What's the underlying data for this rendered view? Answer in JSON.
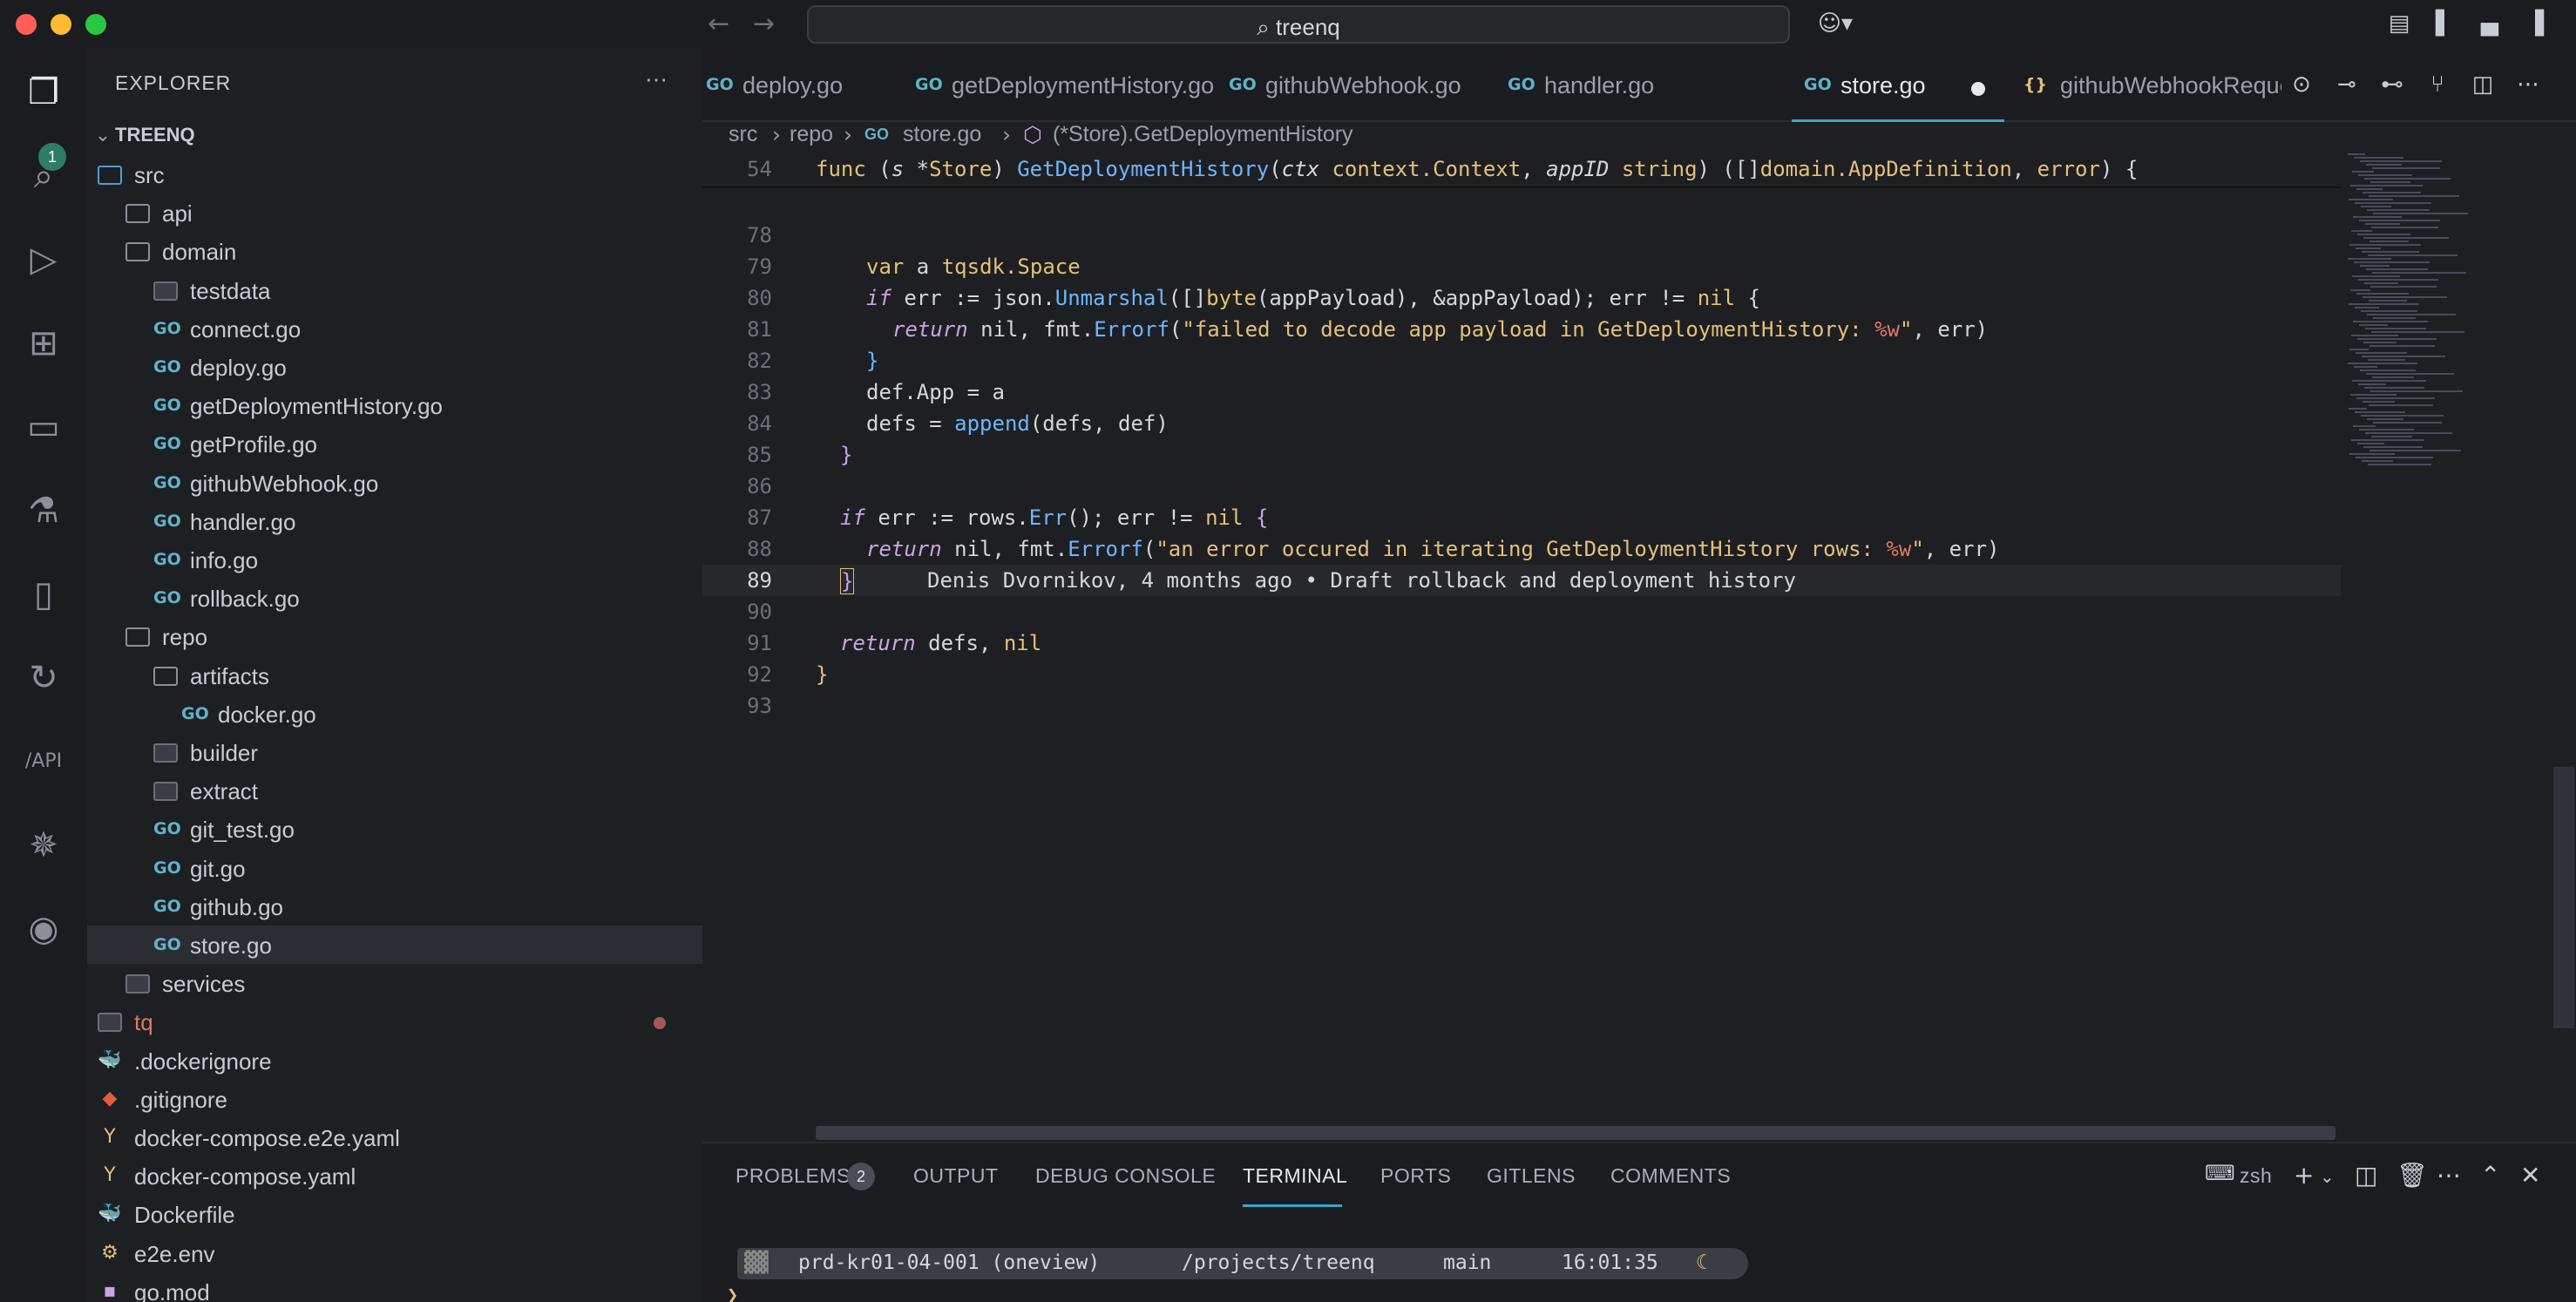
{
  "titlebar": {
    "search_text": "treenq"
  },
  "activity": {
    "explorer_badge": "1"
  },
  "sidebar": {
    "title": "EXPLORER",
    "root": "TREENQ",
    "items": [
      {
        "label": "src",
        "depth": 0,
        "kind": "folder-open"
      },
      {
        "label": "api",
        "depth": 1,
        "kind": "folder"
      },
      {
        "label": "domain",
        "depth": 1,
        "kind": "folder"
      },
      {
        "label": "testdata",
        "depth": 2,
        "kind": "folder-filled"
      },
      {
        "label": "connect.go",
        "depth": 2,
        "kind": "go"
      },
      {
        "label": "deploy.go",
        "depth": 2,
        "kind": "go"
      },
      {
        "label": "getDeploymentHistory.go",
        "depth": 2,
        "kind": "go"
      },
      {
        "label": "getProfile.go",
        "depth": 2,
        "kind": "go"
      },
      {
        "label": "githubWebhook.go",
        "depth": 2,
        "kind": "go"
      },
      {
        "label": "handler.go",
        "depth": 2,
        "kind": "go"
      },
      {
        "label": "info.go",
        "depth": 2,
        "kind": "go"
      },
      {
        "label": "rollback.go",
        "depth": 2,
        "kind": "go"
      },
      {
        "label": "repo",
        "depth": 1,
        "kind": "folder"
      },
      {
        "label": "artifacts",
        "depth": 2,
        "kind": "folder"
      },
      {
        "label": "docker.go",
        "depth": 3,
        "kind": "go"
      },
      {
        "label": "builder",
        "depth": 2,
        "kind": "folder-filled"
      },
      {
        "label": "extract",
        "depth": 2,
        "kind": "folder-filled"
      },
      {
        "label": "git_test.go",
        "depth": 2,
        "kind": "go"
      },
      {
        "label": "git.go",
        "depth": 2,
        "kind": "go"
      },
      {
        "label": "github.go",
        "depth": 2,
        "kind": "go"
      },
      {
        "label": "store.go",
        "depth": 2,
        "kind": "go",
        "selected": true
      },
      {
        "label": "services",
        "depth": 1,
        "kind": "folder-filled"
      },
      {
        "label": "tq",
        "depth": 0,
        "kind": "folder-filled",
        "modified": true
      },
      {
        "label": ".dockerignore",
        "depth": 0,
        "kind": "docker"
      },
      {
        "label": ".gitignore",
        "depth": 0,
        "kind": "git"
      },
      {
        "label": "docker-compose.e2e.yaml",
        "depth": 0,
        "kind": "yaml"
      },
      {
        "label": "docker-compose.yaml",
        "depth": 0,
        "kind": "yaml"
      },
      {
        "label": "Dockerfile",
        "depth": 0,
        "kind": "docker"
      },
      {
        "label": "e2e.env",
        "depth": 0,
        "kind": "env"
      },
      {
        "label": "go.mod",
        "depth": 0,
        "kind": "mod"
      }
    ]
  },
  "tabs": [
    {
      "label": "deploy.go"
    },
    {
      "label": "getDeploymentHistory.go"
    },
    {
      "label": "githubWebhook.go"
    },
    {
      "label": "handler.go"
    },
    {
      "label": "store.go",
      "active": true,
      "dirty": true
    },
    {
      "label": "githubWebhookReque",
      "kind": "json"
    }
  ],
  "breadcrumb": [
    "src",
    "repo",
    "store.go",
    "(*Store).GetDeploymentHistory"
  ],
  "editor": {
    "sticky_line_no": "54",
    "blame": "Denis Dvornikov, 4 months ago • Draft rollback and deployment history",
    "line_numbers": [
      "78",
      "79",
      "80",
      "81",
      "82",
      "83",
      "84",
      "85",
      "86",
      "87",
      "88",
      "89",
      "90",
      "91",
      "92",
      "93"
    ]
  },
  "panel": {
    "tabs": [
      "PROBLEMS",
      "OUTPUT",
      "DEBUG CONSOLE",
      "TERMINAL",
      "PORTS",
      "GITLENS",
      "COMMENTS"
    ],
    "problems_count": "2",
    "shell": "zsh",
    "prompt": {
      "host": "prd-kr01-04-001 (oneview)",
      "path": "/projects/treenq",
      "branch": "main",
      "time": "16:01:35"
    }
  }
}
